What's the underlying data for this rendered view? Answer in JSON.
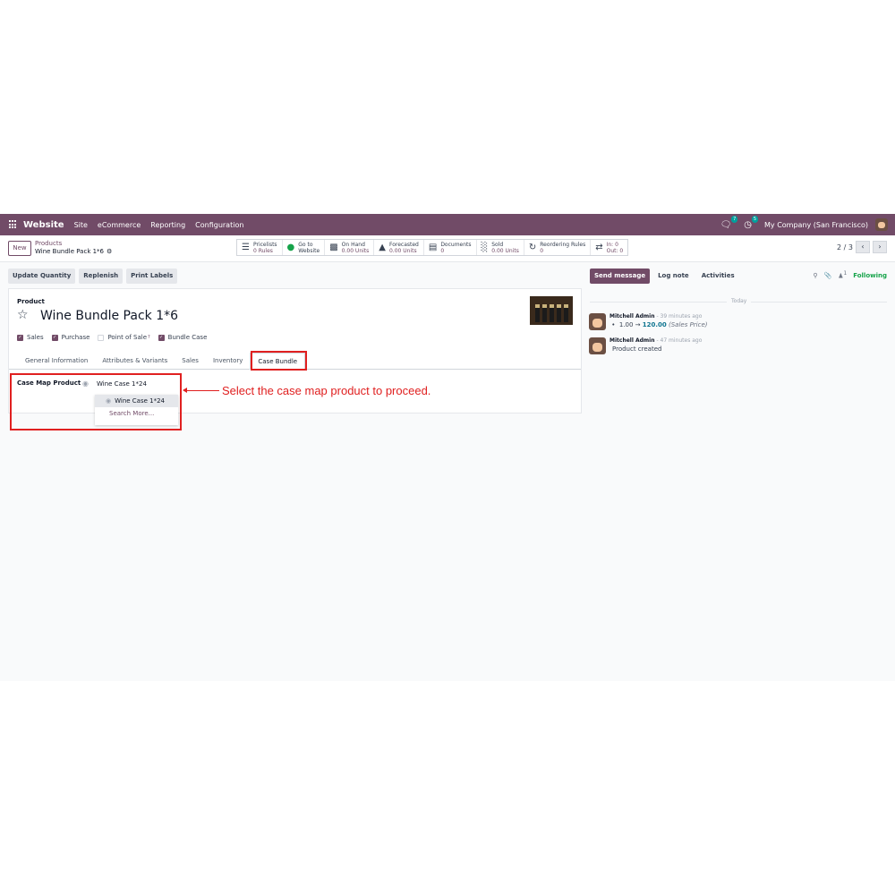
{
  "navbar": {
    "app_name": "Website",
    "menu": [
      "Site",
      "eCommerce",
      "Reporting",
      "Configuration"
    ],
    "chat_count": "7",
    "activity_count": "5",
    "company": "My Company (San Francisco)"
  },
  "control": {
    "new_label": "New",
    "breadcrumb_parent": "Products",
    "breadcrumb_current": "Wine Bundle Pack 1*6",
    "pager": "2 / 3"
  },
  "smart_buttons": [
    {
      "icon": "list-icon",
      "label": "Pricelists",
      "value": "0 Rules"
    },
    {
      "icon": "globe-icon",
      "label": "Go to",
      "value": "Website"
    },
    {
      "icon": "cubes-icon",
      "label": "On Hand",
      "value": "0.00 Units"
    },
    {
      "icon": "area-chart-icon",
      "label": "Forecasted",
      "value": "0.00 Units"
    },
    {
      "icon": "file-icon",
      "label": "Documents",
      "value": "0"
    },
    {
      "icon": "bar-chart-icon",
      "label": "Sold",
      "value": "0.00 Units"
    },
    {
      "icon": "refresh-icon",
      "label": "Reordering Rules",
      "value": "0"
    },
    {
      "icon": "exchange-icon",
      "label": "In: 0",
      "value": "Out: 0"
    }
  ],
  "actions": [
    "Update Quantity",
    "Replenish",
    "Print Labels"
  ],
  "form": {
    "product_label": "Product",
    "product_name": "Wine Bundle Pack 1*6",
    "checks": [
      {
        "label": "Sales",
        "checked": true
      },
      {
        "label": "Purchase",
        "checked": true
      },
      {
        "label": "Point of Sale",
        "checked": false,
        "sup": "?"
      },
      {
        "label": "Bundle Case",
        "checked": true
      }
    ],
    "tabs": [
      "General Information",
      "Attributes & Variants",
      "Sales",
      "Inventory",
      "Case Bundle"
    ],
    "active_tab": "Case Bundle",
    "case_map_label": "Case Map Product",
    "case_map_value": "Wine Case 1*24",
    "dropdown": [
      "Wine Case 1*24",
      "Search More..."
    ]
  },
  "annotation": "Select the case map product to proceed.",
  "chatter": {
    "buttons": [
      "Send message",
      "Log note",
      "Activities"
    ],
    "follower_count": "1",
    "following_label": "Following",
    "today": "Today",
    "messages": [
      {
        "author": "Mitchell Admin",
        "time": "- 39 minutes ago",
        "old": "1.00",
        "arrow": "→",
        "new": "120.00",
        "field": "(Sales Price)"
      },
      {
        "author": "Mitchell Admin",
        "time": "- 47 minutes ago",
        "body": "Product created"
      }
    ]
  },
  "colors": {
    "brand": "#714b67",
    "annotation": "#e02020",
    "following": "#16a34a"
  }
}
